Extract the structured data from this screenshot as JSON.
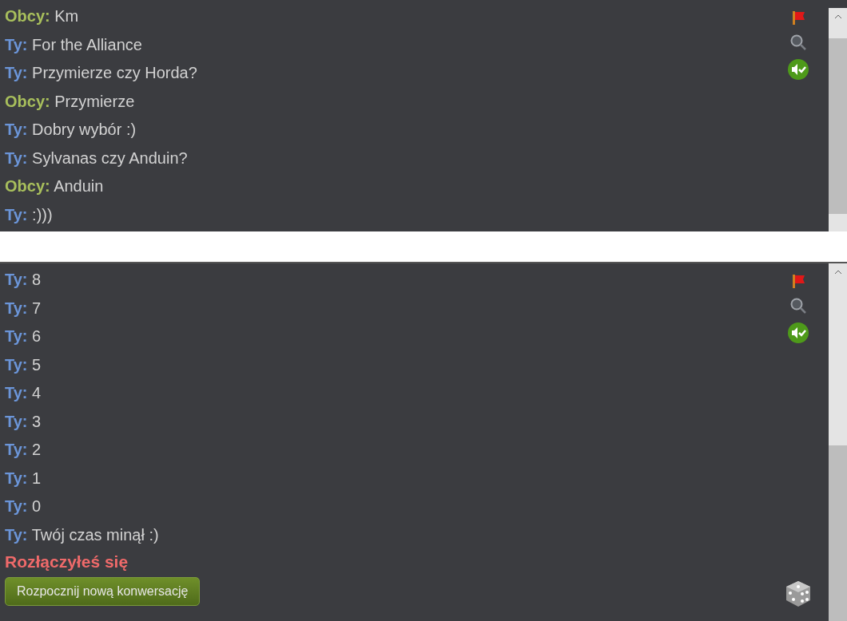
{
  "panels": [
    {
      "messages": [
        {
          "kind": "stranger",
          "sender": "Obcy:",
          "text": "Km"
        },
        {
          "kind": "you",
          "sender": "Ty:",
          "text": "For the Alliance"
        },
        {
          "kind": "you",
          "sender": "Ty:",
          "text": "Przymierze czy Horda?"
        },
        {
          "kind": "stranger",
          "sender": "Obcy:",
          "text": "Przymierze"
        },
        {
          "kind": "you",
          "sender": "Ty:",
          "text": "Dobry wybór :)"
        },
        {
          "kind": "you",
          "sender": "Ty:",
          "text": "Sylvanas czy Anduin?"
        },
        {
          "kind": "stranger",
          "sender": "Obcy:",
          "text": "Anduin"
        },
        {
          "kind": "you",
          "sender": "Ty:",
          "text": ":)))"
        }
      ]
    },
    {
      "messages": [
        {
          "kind": "you",
          "sender": "Ty:",
          "text": "8"
        },
        {
          "kind": "you",
          "sender": "Ty:",
          "text": "7"
        },
        {
          "kind": "you",
          "sender": "Ty:",
          "text": "6"
        },
        {
          "kind": "you",
          "sender": "Ty:",
          "text": "5"
        },
        {
          "kind": "you",
          "sender": "Ty:",
          "text": "4"
        },
        {
          "kind": "you",
          "sender": "Ty:",
          "text": "3"
        },
        {
          "kind": "you",
          "sender": "Ty:",
          "text": "2"
        },
        {
          "kind": "you",
          "sender": "Ty:",
          "text": "1"
        },
        {
          "kind": "you",
          "sender": "Ty:",
          "text": "0"
        },
        {
          "kind": "you",
          "sender": "Ty:",
          "text": "Twój czas minął :)"
        }
      ],
      "status": "Rozłączyłeś się",
      "button": "Rozpocznij nową konwersację"
    }
  ]
}
